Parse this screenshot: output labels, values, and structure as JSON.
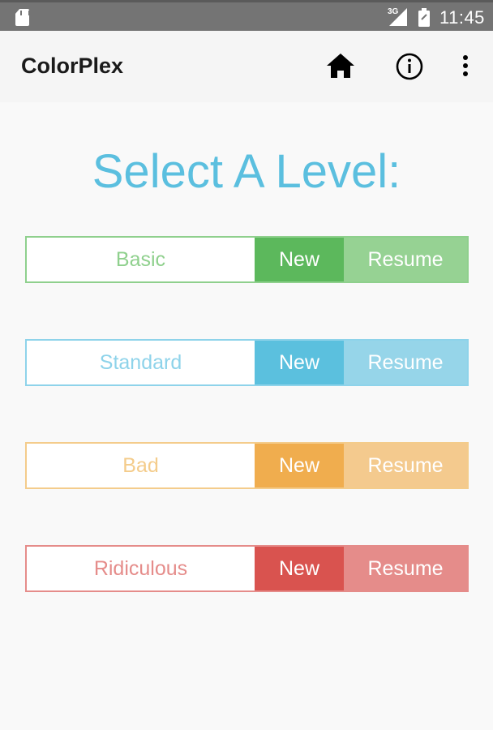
{
  "status_bar": {
    "network_label": "3G",
    "time": "11:45",
    "icons": [
      "sd-card-icon",
      "signal-icon",
      "battery-icon"
    ]
  },
  "toolbar": {
    "title": "ColorPlex",
    "actions": [
      "home-icon",
      "info-icon",
      "more-vertical-icon"
    ]
  },
  "main": {
    "heading": "Select A Level:",
    "levels": [
      {
        "name": "Basic",
        "new_label": "New",
        "resume_label": "Resume",
        "colors": {
          "border": "#8fd08d",
          "name_text": "#8fd08d",
          "new_bg": "#5cb85c",
          "resume_bg": "#96d293"
        }
      },
      {
        "name": "Standard",
        "new_label": "New",
        "resume_label": "Resume",
        "colors": {
          "border": "#8ed3ea",
          "name_text": "#8ed3ea",
          "new_bg": "#5bc0de",
          "resume_bg": "#96d5e9"
        }
      },
      {
        "name": "Bad",
        "new_label": "New",
        "resume_label": "Resume",
        "colors": {
          "border": "#f4cc8b",
          "name_text": "#f4cc8b",
          "new_bg": "#f0ad4e",
          "resume_bg": "#f4ca8e"
        }
      },
      {
        "name": "Ridiculous",
        "new_label": "New",
        "resume_label": "Resume",
        "colors": {
          "border": "#e58c8a",
          "name_text": "#e58c8a",
          "new_bg": "#d9534f",
          "resume_bg": "#e58c8a"
        }
      }
    ]
  }
}
